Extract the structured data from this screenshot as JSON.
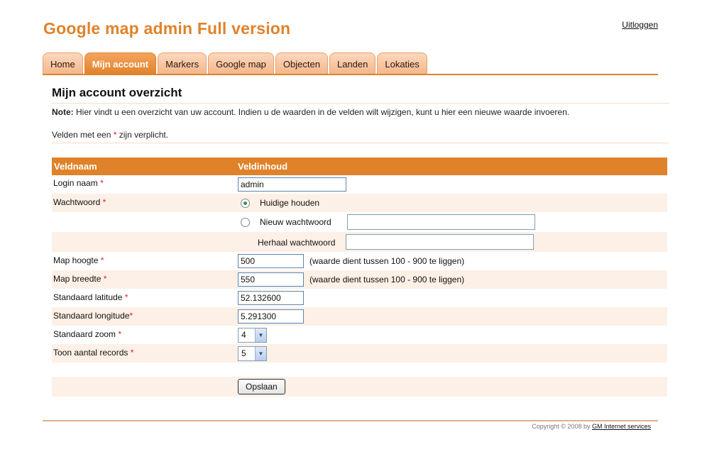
{
  "app": {
    "title": "Google map admin Full version",
    "logout": "Uitloggen"
  },
  "tabs": [
    {
      "label": "Home",
      "active": false
    },
    {
      "label": "Mijn account",
      "active": true
    },
    {
      "label": "Markers",
      "active": false
    },
    {
      "label": "Google map",
      "active": false
    },
    {
      "label": "Objecten",
      "active": false
    },
    {
      "label": "Landen",
      "active": false
    },
    {
      "label": "Lokaties",
      "active": false
    }
  ],
  "page": {
    "title": "Mijn account overzicht",
    "note_label": "Note:",
    "note_text": " Hier vindt u een overzicht van uw account. Indien u de waarden in de velden wilt wijzigen, kunt u hier een nieuwe waarde invoeren.",
    "required_pre": "Velden met een ",
    "required_star": "*",
    "required_post": " zijn verplicht."
  },
  "table": {
    "header_field": "Veldnaam",
    "header_value": "Veldinhoud",
    "login_label": "Login naam",
    "login_value": "admin",
    "password_label": "Wachtwoord",
    "keep_password": "Huidige houden",
    "new_password": "Nieuw wachtwoord",
    "repeat_password": "Herhaal wachtwoord",
    "map_height_label": "Map hoogte",
    "map_height_value": "500",
    "map_height_hint": "(waarde dient tussen 100 - 900 te liggen)",
    "map_width_label": "Map breedte",
    "map_width_value": "550",
    "map_width_hint": "(waarde dient tussen 100 - 900 te liggen)",
    "lat_label": "Standaard latitude",
    "lat_value": "52.132600",
    "lng_label": "Standaard longitude",
    "lng_value": "5.291300",
    "zoom_label": "Standaard zoom",
    "zoom_value": "4",
    "records_label": "Toon aantal records",
    "records_value": "5",
    "save_label": "Opslaan",
    "star": "*"
  },
  "footer": {
    "copyright": "Copyright © 2008 by ",
    "company": "GM Internet services"
  },
  "colors": {
    "accent": "#e0822a",
    "row_alt": "#fdf0e6",
    "required": "#dd2222"
  },
  "icons": {
    "radio_selected": "radio-selected-icon",
    "radio_empty": "radio-empty-icon",
    "dropdown": "chevron-down-icon"
  }
}
